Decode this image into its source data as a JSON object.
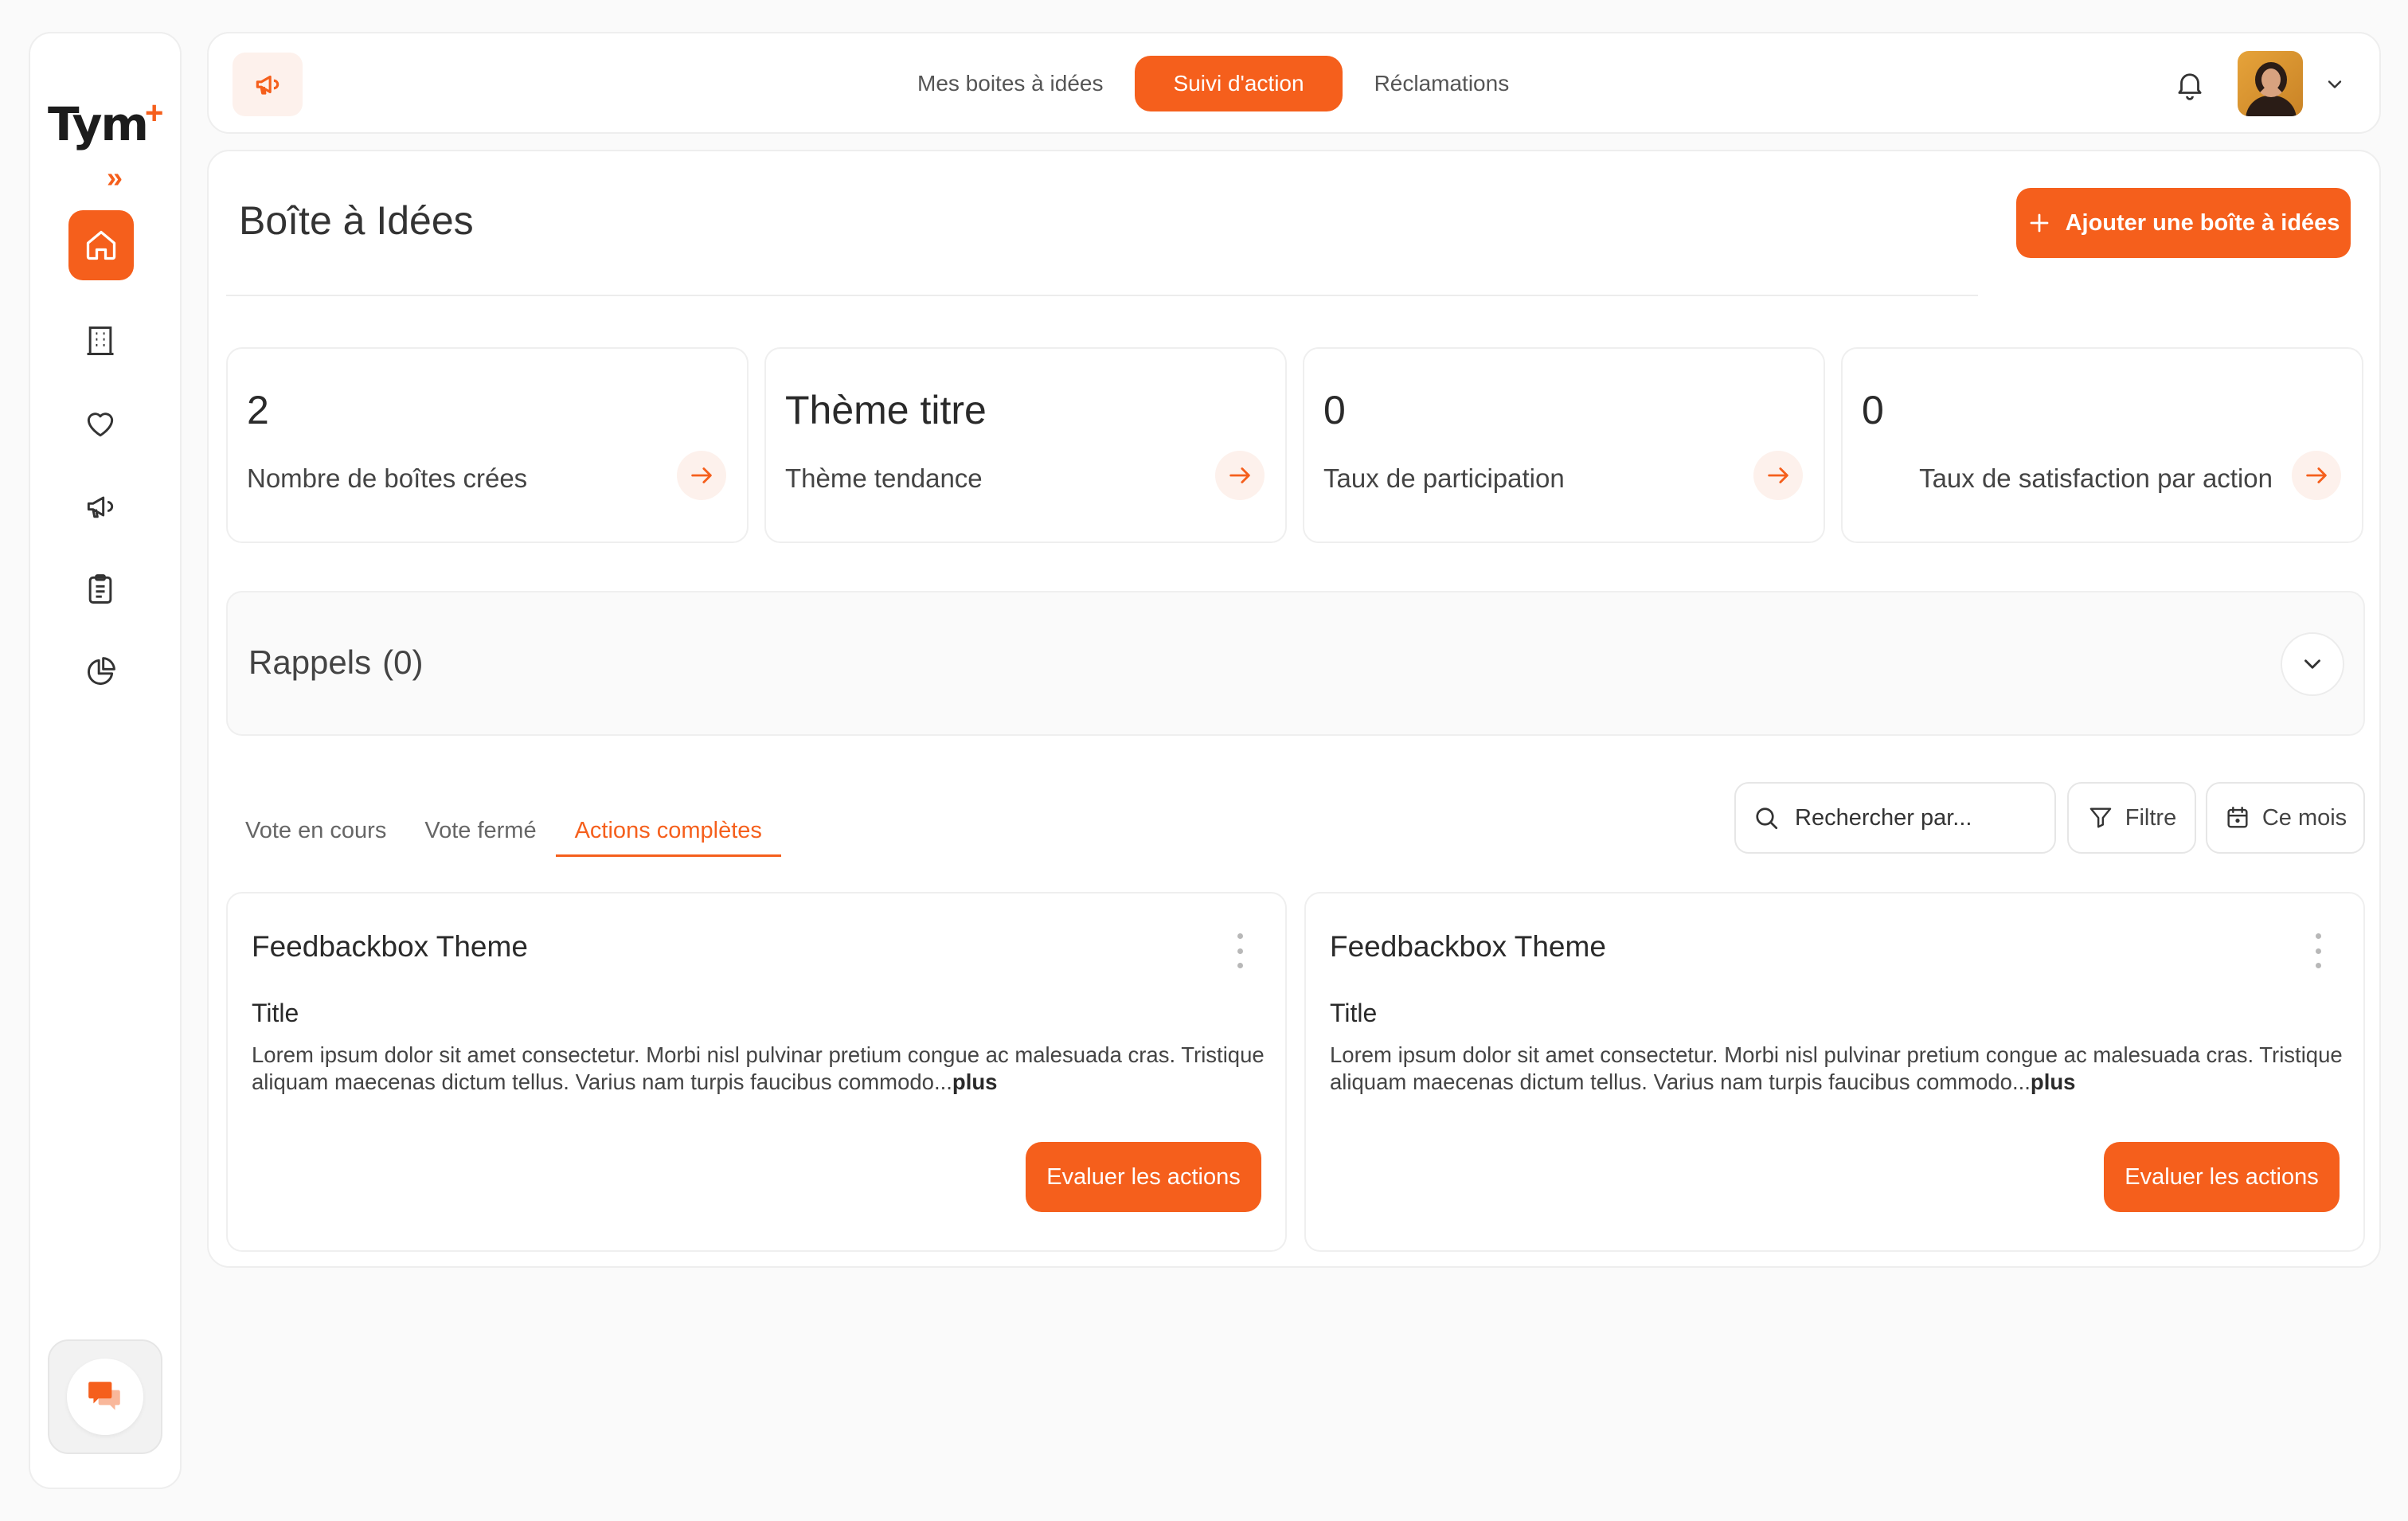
{
  "brand": {
    "logo_text": "Tym",
    "logo_mark": "+",
    "expand_icon": "»",
    "accent_color": "#f55f1c"
  },
  "sidebar": {
    "items": [
      {
        "icon": "home-icon",
        "active": true
      },
      {
        "icon": "building-icon",
        "active": false
      },
      {
        "icon": "heart-icon",
        "active": false
      },
      {
        "icon": "megaphone-icon",
        "active": false
      },
      {
        "icon": "clipboard-icon",
        "active": false
      },
      {
        "icon": "pie-chart-icon",
        "active": false
      }
    ],
    "chat_icon": "chat-bubbles-icon"
  },
  "topbar": {
    "tabs": [
      {
        "label": "Mes boites à idées",
        "active": false
      },
      {
        "label": "Suivi d'action",
        "active": true
      },
      {
        "label": "Réclamations",
        "active": false
      }
    ]
  },
  "page": {
    "title": "Boîte à Idées",
    "add_button": "Ajouter une boîte à idées"
  },
  "stats": [
    {
      "value": "2",
      "label": "Nombre de boîtes crées"
    },
    {
      "value": "Thème titre",
      "label": "Thème tendance"
    },
    {
      "value": "0",
      "label": "Taux de participation"
    },
    {
      "value": "0",
      "label": "Taux de satisfaction par action"
    }
  ],
  "rappels": {
    "label": "Rappels",
    "count": "(0)"
  },
  "subtabs": [
    {
      "label": "Vote en cours",
      "active": false
    },
    {
      "label": "Vote fermé",
      "active": false
    },
    {
      "label": "Actions complètes",
      "active": true
    }
  ],
  "toolbar": {
    "search_placeholder": "Rechercher par...",
    "filter_label": "Filtre",
    "period_label": "Ce mois"
  },
  "cards": [
    {
      "theme": "Feedbackbox Theme",
      "title": "Title",
      "description": "Lorem ipsum dolor sit amet consectetur. Morbi nisl pulvinar pretium congue ac malesuada cras. Tristique aliquam maecenas dictum tellus. Varius nam turpis faucibus commodo...",
      "more": "plus",
      "button": "Evaluer les actions"
    },
    {
      "theme": "Feedbackbox Theme",
      "title": "Title",
      "description": "Lorem ipsum dolor sit amet consectetur. Morbi nisl pulvinar pretium congue ac malesuada cras. Tristique aliquam maecenas dictum tellus. Varius nam turpis faucibus commodo...",
      "more": "plus",
      "button": "Evaluer les actions"
    }
  ]
}
